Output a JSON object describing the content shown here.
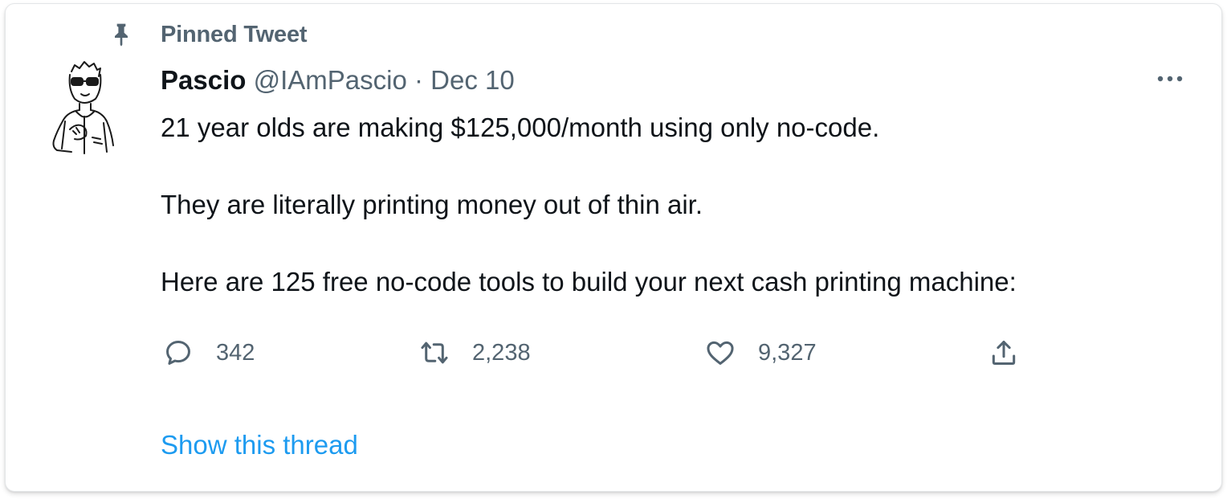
{
  "colors": {
    "primary_text": "#0f1419",
    "secondary_text": "#536471",
    "link": "#1d9bf0",
    "border": "#e4e6e8"
  },
  "pinned": {
    "label": "Pinned Tweet",
    "icon": "pin-icon"
  },
  "author": {
    "display_name": "Pascio",
    "handle": "@IAmPascio",
    "separator": "·",
    "date": "Dec 10",
    "avatar_icon": "avatar-sketch"
  },
  "tweet": {
    "lines": [
      "21 year olds are making $125,000/month using only no-code.",
      "They are literally printing money out of thin air.",
      "Here are 125 free no-code tools to build your next cash printing machine:"
    ]
  },
  "actions": {
    "reply": {
      "icon": "reply-icon",
      "count": "342"
    },
    "retweet": {
      "icon": "retweet-icon",
      "count": "2,238"
    },
    "like": {
      "icon": "heart-icon",
      "count": "9,327"
    },
    "share": {
      "icon": "share-icon"
    }
  },
  "more_icon": "more-icon",
  "show_thread": "Show this thread"
}
